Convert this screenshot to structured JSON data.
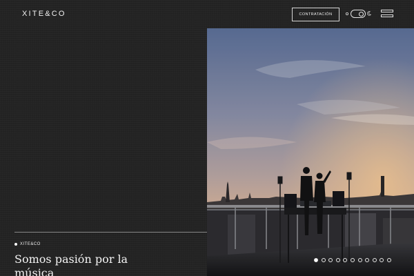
{
  "header": {
    "logo": "XITE&CO",
    "cta_label": "CONTRATACIÓN",
    "theme_toggle": {
      "icons": [
        "sun-icon",
        "moon-icon"
      ],
      "state": "dark"
    },
    "menu_icon": "hamburger-icon"
  },
  "hero": {
    "tag": "XITE&CO",
    "headline": "Somos pasión por la música",
    "image_subject": "photo",
    "carousel": {
      "count": 11,
      "active_index": 0
    }
  },
  "colors": {
    "background": "#222222",
    "text": "#f2f2f2",
    "line": "#8a8a8a"
  }
}
